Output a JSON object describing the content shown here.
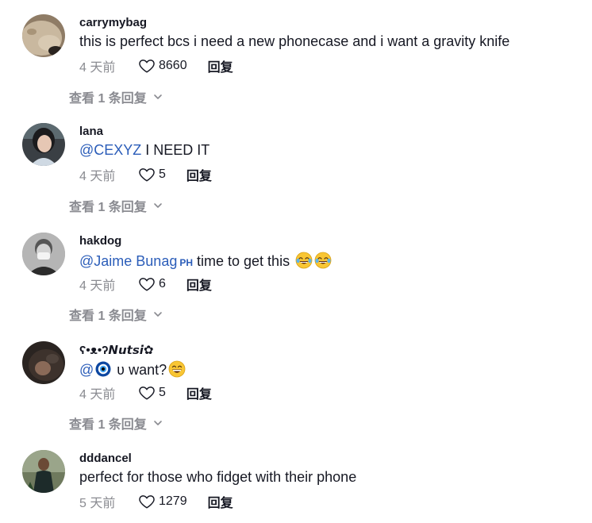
{
  "comments": [
    {
      "username": "carrymybag",
      "text": "this is perfect bcs i need a new phonecase and i want a gravity knife",
      "time": "4 天前",
      "likes": "8660",
      "reply_label": "回复",
      "view_replies": "查看 1 条回复"
    },
    {
      "username": "lana",
      "mention": "@CEXYZ",
      "text": " I NEED IT",
      "time": "4 天前",
      "likes": "5",
      "reply_label": "回复",
      "view_replies": "查看 1 条回复"
    },
    {
      "username": "hakdog",
      "mention": "@Jaime Bunag",
      "mention_badge": "PH",
      "text": " time to get this ",
      "time": "4 天前",
      "likes": "6",
      "reply_label": "回复",
      "view_replies": "查看 1 条回复"
    },
    {
      "username": "ʕ•ᴥ•ʔ𝙉𝙪𝙩𝙨𝙞✿",
      "mention": "@",
      "text": " ʋ want?",
      "time": "4 天前",
      "likes": "5",
      "reply_label": "回复",
      "view_replies": "查看 1 条回复"
    },
    {
      "username": "dddancel",
      "text": "perfect for those who fidget with their phone",
      "time": "5 天前",
      "likes": "1279",
      "reply_label": "回复"
    }
  ],
  "icons": {
    "like": "heart-outline-icon",
    "expand": "chevron-down-icon",
    "laugh": "tears-of-joy-emoji",
    "grin": "grinning-emoji",
    "evil_eye": "nazar-amulet-emoji"
  },
  "colors": {
    "text": "#161823",
    "muted": "#8a8b91",
    "mention": "#2b5db9"
  }
}
